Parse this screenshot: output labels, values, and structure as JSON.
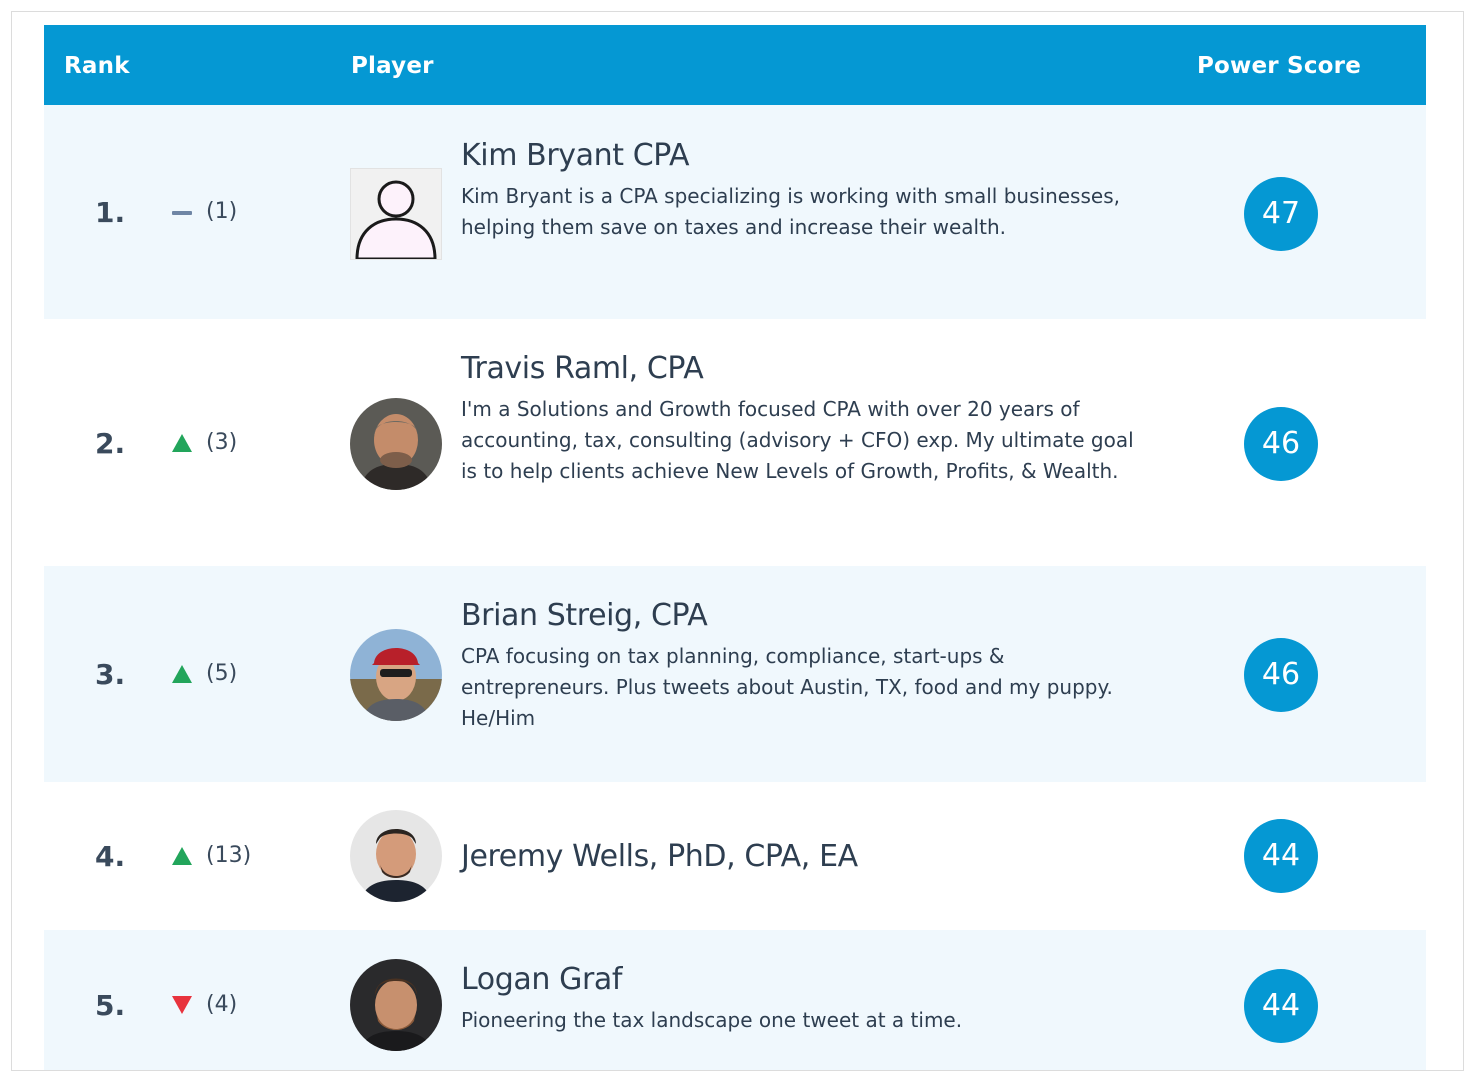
{
  "header": {
    "rank_label": "Rank",
    "player_label": "Player",
    "score_label": "Power Score"
  },
  "colors": {
    "header_bg": "#0598d3",
    "score_badge": "#0598d3",
    "row_alt_bg": "#f0f8fd",
    "trend_up": "#22a55b",
    "trend_down": "#e8333d",
    "trend_same": "#6f86a5"
  },
  "players": [
    {
      "rank": "1.",
      "trend": "same",
      "previous": "(1)",
      "name": "Kim Bryant CPA",
      "bio": "Kim Bryant is a CPA specializing is working with small businesses, helping them save on taxes and increase their wealth.",
      "avatar": "default-user-icon",
      "score": "47"
    },
    {
      "rank": "2.",
      "trend": "up",
      "previous": "(3)",
      "name": "Travis Raml, CPA",
      "bio": "I'm a Solutions and Growth focused CPA with over 20 years of accounting, tax, consulting (advisory + CFO) exp. My ultimate goal is to help clients achieve New Levels of Growth, Profits, & Wealth.",
      "avatar": "profile-photo",
      "score": "46"
    },
    {
      "rank": "3.",
      "trend": "up",
      "previous": "(5)",
      "name": "Brian Streig, CPA",
      "bio": "CPA focusing on tax planning, compliance, start-ups & entrepreneurs. Plus tweets about Austin, TX, food and my puppy. He/Him",
      "avatar": "profile-photo",
      "score": "46"
    },
    {
      "rank": "4.",
      "trend": "up",
      "previous": "(13)",
      "name": "Jeremy Wells, PhD, CPA, EA",
      "bio": "",
      "avatar": "profile-photo",
      "score": "44"
    },
    {
      "rank": "5.",
      "trend": "down",
      "previous": "(4)",
      "name": "Logan Graf",
      "bio": "Pioneering the tax landscape one tweet at a time.",
      "avatar": "profile-photo",
      "score": "44"
    }
  ]
}
